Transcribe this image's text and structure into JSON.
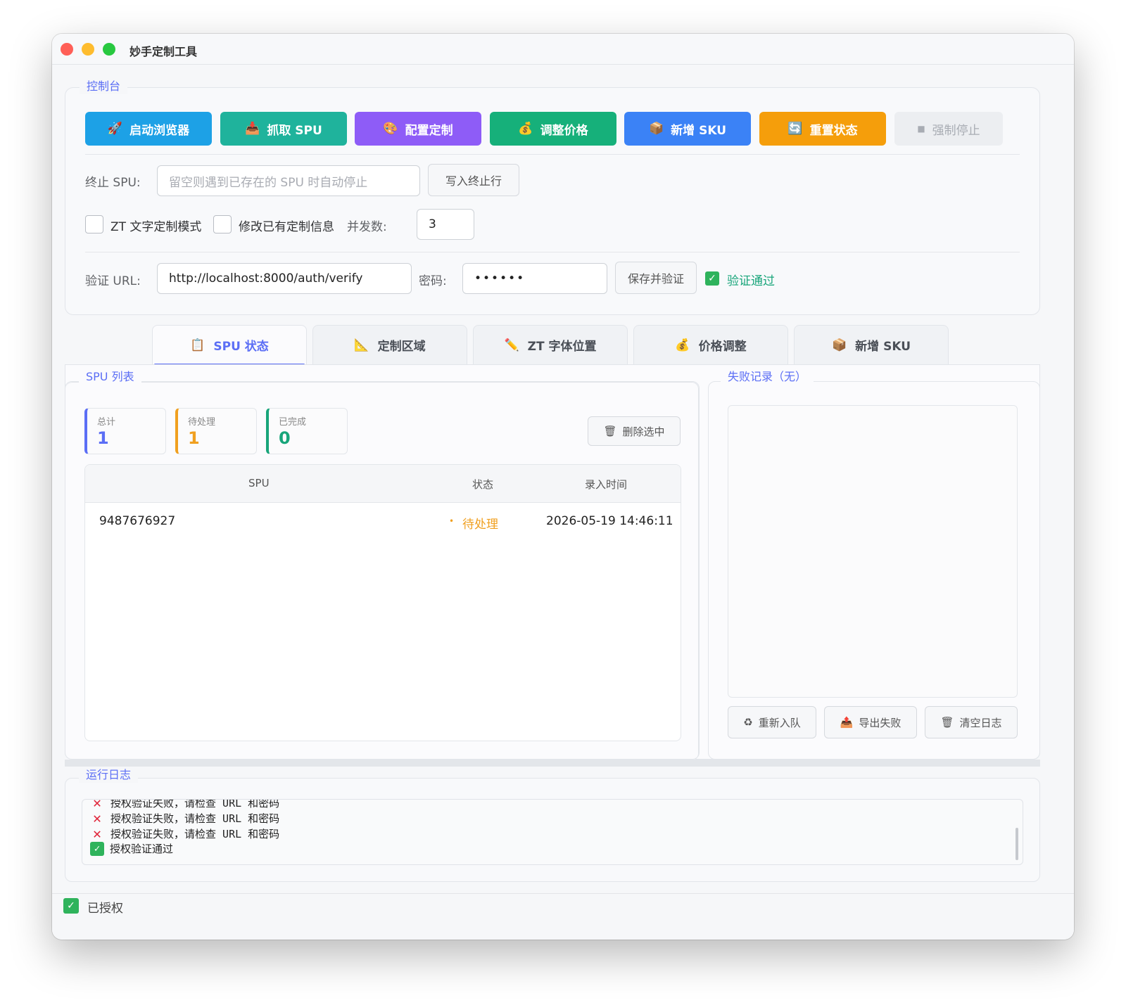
{
  "window": {
    "title": "妙手定制工具"
  },
  "console": {
    "title": "控制台",
    "buttons": [
      {
        "label": "启动浏览器",
        "icon": "🚀",
        "color": "#1da1e6"
      },
      {
        "label": "抓取 SPU",
        "icon": "📥",
        "color": "#1fb39c"
      },
      {
        "label": "配置定制",
        "icon": "🎨",
        "color": "#8e5cf7"
      },
      {
        "label": "调整价格",
        "icon": "💰",
        "color": "#16b07a"
      },
      {
        "label": "新增 SKU",
        "icon": "📦",
        "color": "#3b82f6"
      },
      {
        "label": "重置状态",
        "icon": "🔄",
        "color": "#f59e0b"
      },
      {
        "label": "强制停止",
        "icon": "■",
        "color": "#eceef1"
      }
    ],
    "stop_spu_label": "终止 SPU:",
    "stop_spu_placeholder": "留空则遇到已存在的 SPU 时自动停止",
    "write_stop_label": "写入终止行",
    "zt_mode_label": "ZT 文字定制模式",
    "modify_label": "修改已有定制信息",
    "concurrency_label": "并发数:",
    "concurrency_value": "3",
    "verify_url_label": "验证 URL:",
    "verify_url_value": "http://localhost:8000/auth/verify",
    "password_label": "密码:",
    "password_value": "••••••",
    "save_verify_label": "保存并验证",
    "verify_status": "验证通过"
  },
  "tabs": [
    {
      "label": "SPU 状态",
      "icon": "📋"
    },
    {
      "label": "定制区域",
      "icon": "📐"
    },
    {
      "label": "ZT 字体位置",
      "icon": "✏️"
    },
    {
      "label": "价格调整",
      "icon": "💰"
    },
    {
      "label": "新增 SKU",
      "icon": "📦"
    }
  ],
  "spu_list": {
    "title": "SPU 列表",
    "stats": [
      {
        "label": "总计",
        "value": "1",
        "color": "#5b6ef5"
      },
      {
        "label": "待处理",
        "value": "1",
        "color": "#f0a020"
      },
      {
        "label": "已完成",
        "value": "0",
        "color": "#18a57a"
      }
    ],
    "delete_label": "删除选中",
    "columns": [
      "SPU",
      "状态",
      "录入时间"
    ],
    "rows": [
      {
        "spu": "9487676927",
        "status": "待处理",
        "time": "2026-05-19 14:46:11"
      }
    ]
  },
  "fail_log": {
    "title": "失败记录（无）",
    "requeue_label": "重新入队",
    "export_label": "导出失败",
    "clear_label": "清空日志"
  },
  "run_log": {
    "title": "运行日志",
    "lines": [
      {
        "type": "error",
        "text": "授权验证失败，请检查 URL 和密码"
      },
      {
        "type": "error",
        "text": "授权验证失败，请检查 URL 和密码"
      },
      {
        "type": "error",
        "text": "授权验证失败，请检查 URL 和密码"
      },
      {
        "type": "ok",
        "text": "授权验证通过"
      }
    ]
  },
  "statusbar": {
    "text": "已授权"
  }
}
